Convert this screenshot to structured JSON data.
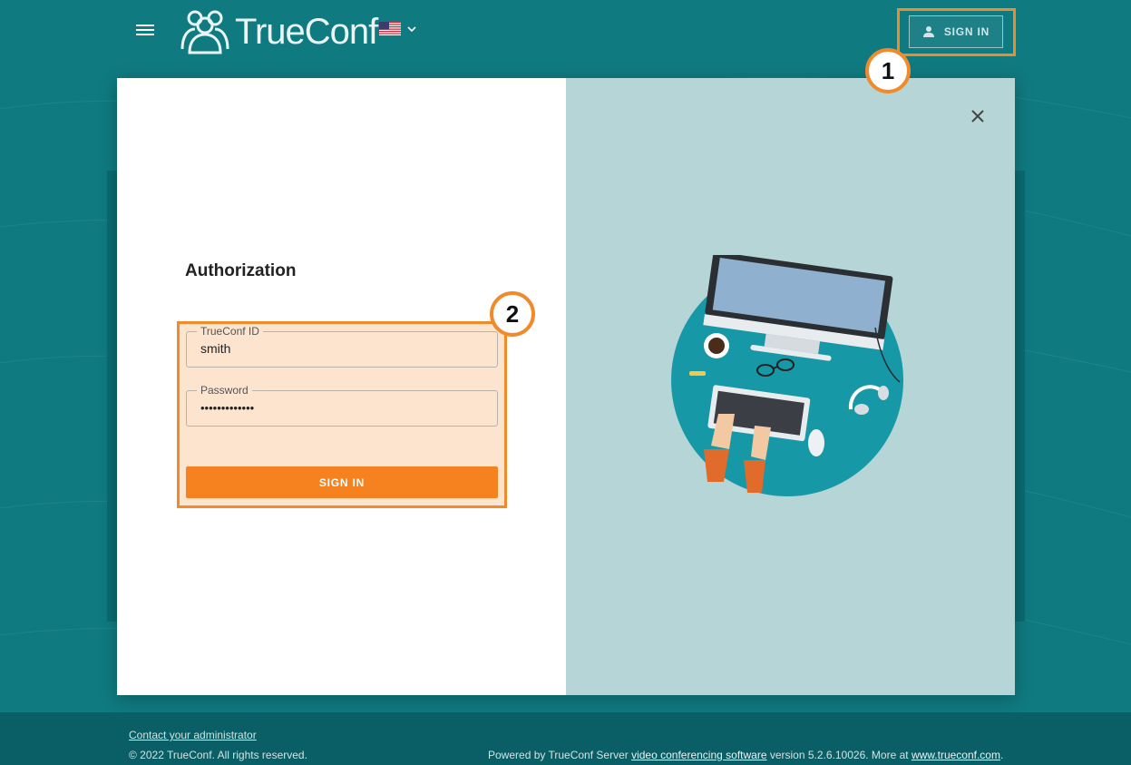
{
  "header": {
    "logo_text": "TrueConf",
    "language": "en-US",
    "signin_label": "SIGN IN"
  },
  "callouts": {
    "one": "1",
    "two": "2"
  },
  "modal": {
    "title": "Authorization",
    "fields": {
      "id_label": "TrueConf ID",
      "id_value": "smith",
      "password_label": "Password",
      "password_value": "•••••••••••••"
    },
    "signin_label": "SIGN IN"
  },
  "footer": {
    "contact": "Contact your administrator",
    "copyright": "© 2022 TrueConf. All rights reserved.",
    "powered_prefix": "Powered by TrueConf Server ",
    "powered_link": "video conferencing software",
    "powered_middle": " version 5.2.6.10026. More at ",
    "site_link": "www.trueconf.com",
    "powered_suffix": "."
  },
  "colors": {
    "background": "#0f7a80",
    "accent": "#f5821f",
    "highlight": "#f08a2b",
    "panel_right": "#b6d5d6"
  }
}
